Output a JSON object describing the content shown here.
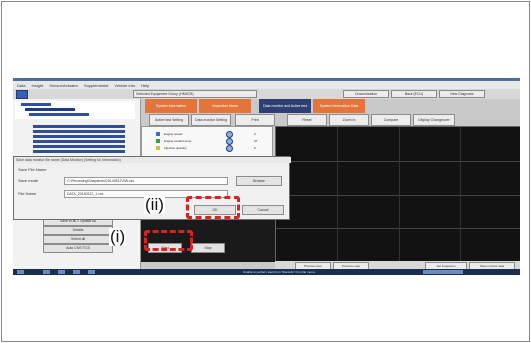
{
  "menu_items": [
    "Data",
    "Insight",
    "Sensor/Actuator",
    "Supplemental",
    "Vehicle Info",
    "Help"
  ],
  "device_title": "Selected Equipment Group (HMI/CB)",
  "header_buttons": [
    "Customization",
    "Back (ECU)",
    "New Diagnosis"
  ],
  "tabs": [
    "System Information",
    "Inspection Menu",
    "Data monitor and Active test",
    "System Information Data"
  ],
  "sub_buttons": [
    "Active test Setting",
    "Data monitor Setting",
    "Print",
    "Reset",
    "Zoom In",
    "Compare",
    "Display Changeover"
  ],
  "left_buttons": [
    "Save in all = Update All",
    "Details",
    "Select all",
    "Auto CMT/TCS"
  ],
  "list_rows": [
    {
      "label": "Engine speed",
      "color": "#3c6ec9",
      "value": "0"
    },
    {
      "label": "Engine coolant temp",
      "color": "#2ca53b",
      "value": "47"
    },
    {
      "label": "Injection quantity",
      "color": "#d0c23a",
      "value": "0"
    }
  ],
  "graph_buttons": [
    "Previous item",
    "Previous step",
    "Set Inspection",
    "Save monitor data"
  ],
  "dialog": {
    "title": "Save data monitor file name (Data Monitor) (Setting for Information)",
    "section": "Save File Name",
    "save_mode_label": "Save mode",
    "save_mode_value": "C:\\Recording\\Snapshots\\20140512\\SW.csv",
    "file_name_label": "File Name",
    "file_name_value": "DATA_20140512_1.csv",
    "browse_label": "Browse",
    "ok_label": "OK",
    "cancel_label": "Cancel"
  },
  "start_label": "Start",
  "stop_label": "Stop",
  "callouts": {
    "ok": "(ii)",
    "start": "(i)"
  },
  "taskbar_hint": "Unable to perform start from \"Records\" from file menu."
}
